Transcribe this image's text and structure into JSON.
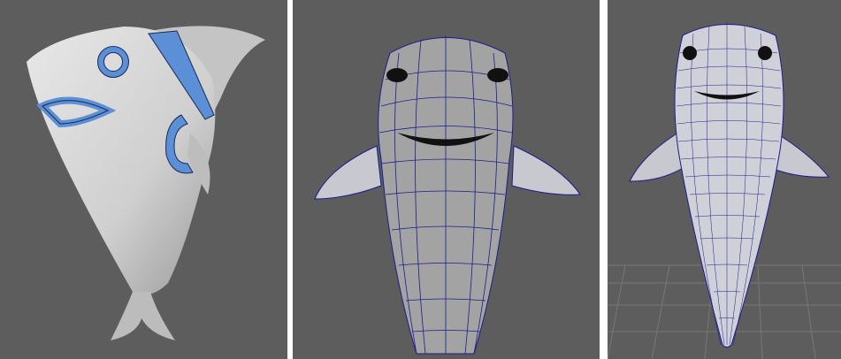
{
  "viewports": [
    {
      "id": "viewport-selection",
      "mode": "smooth-shaded-with-selected-edge-loops"
    },
    {
      "id": "viewport-lowpoly",
      "mode": "low-poly-wireframe-on-shaded"
    },
    {
      "id": "viewport-subdivided",
      "mode": "subdivided-wireframe-on-shaded",
      "ground_grid": true
    }
  ],
  "colors": {
    "viewport_bg": "#5d5d5d",
    "mesh_surface": "#c8c8c8",
    "mesh_shadow": "#8a8a8a",
    "selection_fill": "#5b8fd6",
    "selection_edge": "#1a2a55",
    "wireframe": "#1c1c8c",
    "ground_grid": "#777777",
    "separator": "#ffffff"
  },
  "icons": [
    "shark-model-icon"
  ]
}
